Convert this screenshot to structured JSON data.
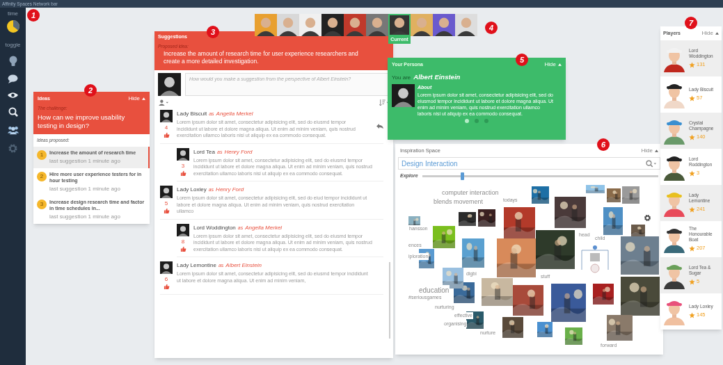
{
  "network_bar": {
    "title": "Affinity Spaces Network bar"
  },
  "sidebar": {
    "time_label": "time",
    "toggle_label": "toggle"
  },
  "callouts": [
    "1",
    "2",
    "3",
    "4",
    "5",
    "6",
    "7"
  ],
  "ideas": {
    "title": "Ideas",
    "hide": "Hide",
    "challenge_label": "The challenge:",
    "challenge": "How can we improve usability testing in design?",
    "proposed_label": "Ideas proposed:",
    "items": [
      {
        "rank": "1",
        "text": "Increase the amount of research time",
        "meta": "last suggestion 1 minute ago",
        "selected": true
      },
      {
        "rank": "2",
        "text": "Hire more user experience testers for in hour testing",
        "meta": "last suggestion 1 minute ago",
        "selected": false
      },
      {
        "rank": "3",
        "text": "Increase design research time and factor in time schedules in...",
        "meta": "last suggestion 1 minute ago",
        "selected": false
      }
    ]
  },
  "portraits": {
    "current_label": "Current",
    "items": [
      {
        "selected": false
      },
      {
        "selected": false
      },
      {
        "selected": false
      },
      {
        "selected": false
      },
      {
        "selected": false
      },
      {
        "selected": false
      },
      {
        "selected": true
      },
      {
        "selected": false
      },
      {
        "selected": false
      },
      {
        "selected": false
      }
    ]
  },
  "suggestions": {
    "title": "Suggestions",
    "proposed_label": "Proposed idea:",
    "proposed": "Increase the amount of research time for user experience researchers and create a more detailed investigation.",
    "placeholder": "How would you make a suggestion from the perspective of Albert Einstein?",
    "comments": [
      {
        "author": "Lady Biscuit",
        "as": "as",
        "persona": "Angella Merkel",
        "text": "Lorem ipsum dolor sit amet, consectetur adipisicing elit, sed do eiusmd tempor incididunt ut labore et dolore magna aliqua. Ut enim ad minim veniam, quis nostrud exercitation ullamco laboris nisi ut aliquip ex ea commodo consequat.",
        "votes": "4",
        "children": [
          {
            "author": "Lord Tea",
            "as": "as",
            "persona": "Henry Ford",
            "text": "Lorem ipsum dolor sit amet, consectetur adipisicing elit, sed do eiusmd tempor incididunt ut labore et dolore magna aliqua. Ut enim ad minim veniam, quis nostrud exercitation ullamco laboris nisi ut aliquip ex ea commodo consequat.",
            "votes": "3"
          }
        ]
      },
      {
        "author": "Lady Loxley",
        "as": "as",
        "persona": "Henry Ford",
        "text": "Lorem ipsum dolor sit amet, consectetur adipisicing elit, sed do eiud tempor incididunt ut labore et dolore magna aliqua. Ut enim ad minim veniam, quis nostrud exercitation ullamco",
        "votes": "5",
        "children": [
          {
            "author": "Lord Woddington",
            "as": "as",
            "persona": "Angella Merkel",
            "text": "Lorem ipsum dolor sit amet, consectetur adipisicing elit, sed do eiusmd tempor incididunt ut labore et dolore magna aliqua. Ut enim ad minim veniam, quis nostrud exercitation ullamco laboris nisi ut aliquip ex ea commodo consequat.",
            "votes": "8"
          }
        ]
      },
      {
        "author": "Lady Lemontine",
        "as": "as",
        "persona": "Albert Einstein",
        "text": "Lorem ipsum dolor sit amet, consectetur adipisicing elit, sed do eiusmd tempor incididunt ut labore et dolore magna aliqua. Ut enim ad minim veniam,",
        "votes": "6"
      }
    ]
  },
  "persona": {
    "title": "Your Persona",
    "hide": "Hide",
    "you_are_label": "You are",
    "name": "Albert Einstein",
    "about_label": "About",
    "about": "Lorem ipsum dolor sit amet, consectetur adipisicing elit, sed do eiusmod tempor incididunt ut labore et dolore magna aliqua. Ut enim ad minim veniam, quis nostrud exercitation ullamco laboris nisi ut aliquip ex ea commodo consequat.",
    "pages": [
      {
        "selected": true
      },
      {
        "selected": false
      },
      {
        "selected": false
      }
    ]
  },
  "inspiration": {
    "title": "Inspiration Space",
    "hide": "Hide",
    "search_value": "Design Interaction",
    "explore_label": "Explore",
    "level": 0.17,
    "words": [
      "computer interaction",
      "blends movement",
      "todays",
      "hansson",
      "ences",
      "iploration",
      "digbi",
      "education",
      "#seriousgames",
      "nurturing",
      "effective",
      "organising",
      "nurture",
      "stuff",
      "head",
      "child",
      "forward"
    ]
  },
  "players": {
    "title": "Players",
    "hide": "Hide",
    "items": [
      {
        "name": "Lord Woddington",
        "score": "131"
      },
      {
        "name": "Lady Biscuit",
        "score": "57"
      },
      {
        "name": "Crystal Champagne",
        "score": "140"
      },
      {
        "name": "Lord Roddington",
        "score": "3"
      },
      {
        "name": "Lady Lemontine",
        "score": "241"
      },
      {
        "name": "The Honourable Boat",
        "score": "207"
      },
      {
        "name": "Lord Tea & Sugar",
        "score": "5"
      },
      {
        "name": "Lady Loxley",
        "score": "145"
      }
    ]
  }
}
